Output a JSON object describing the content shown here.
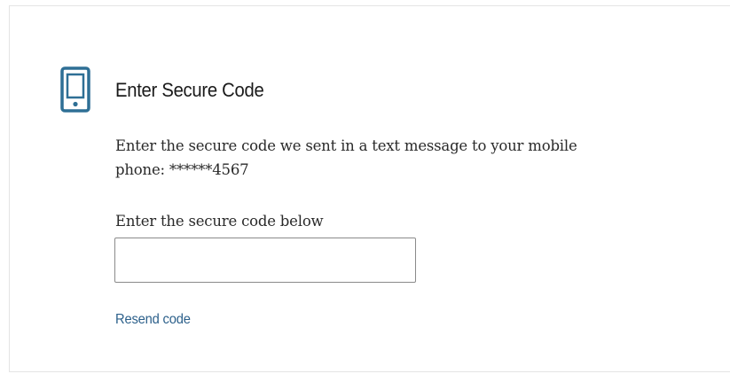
{
  "header": {
    "title": "Enter Secure Code",
    "icon": "mobile-phone-icon"
  },
  "message": {
    "text": "Enter the secure code we sent in a text message to your mobile phone: ******4567"
  },
  "code_field": {
    "label": "Enter the secure code below",
    "value": "",
    "placeholder": ""
  },
  "actions": {
    "resend_label": "Resend code"
  },
  "colors": {
    "icon": "#2e6f95",
    "link": "#2b5f8a",
    "border": "#8a8a8a"
  }
}
